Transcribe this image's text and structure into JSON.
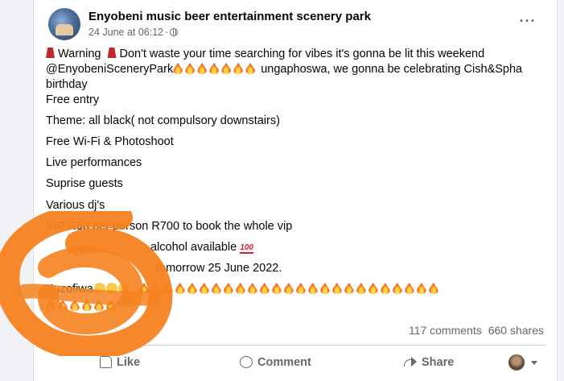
{
  "post": {
    "page_name": "Enyobeni music beer entertainment scenery park",
    "date": "24 June at 06:12",
    "separator": "·",
    "more_icon": "more-horizontal-icon",
    "privacy_icon": "globe-icon",
    "warning_word": "Warning",
    "line1_rest": "Don't waste your time searching for vibes it's gonna be lit this weekend",
    "mention": "@EnyobeniSceneryPark",
    "line2_rest": "ungaphoswa, we gonna be celebrating Cish&Spha",
    "line3": "birthday",
    "line4": "Free entry",
    "line5": "Theme: all black( not compulsory downstairs)",
    "line6": "Free Wi-Fi & Photoshoot",
    "line7": "Live performances",
    "line8": "Suprise guests",
    "line9": "Various dj's",
    "line10": "VIP:R50 per person R700 to book the whole vip",
    "line11": "alcohol available",
    "hundred": "100",
    "line12": "tomorrow 25  June 2022.",
    "line13_start": "Kuzofiwa",
    "fire_icon": "fire-icon"
  },
  "stats": {
    "comments": "117 comments",
    "shares": "660 shares"
  },
  "actions": {
    "like": "Like",
    "comment": "Comment",
    "share": "Share"
  },
  "colors": {
    "text": "#050505",
    "secondary": "#65676b",
    "overlay": "#f58220",
    "background": "#f0f2f5"
  }
}
